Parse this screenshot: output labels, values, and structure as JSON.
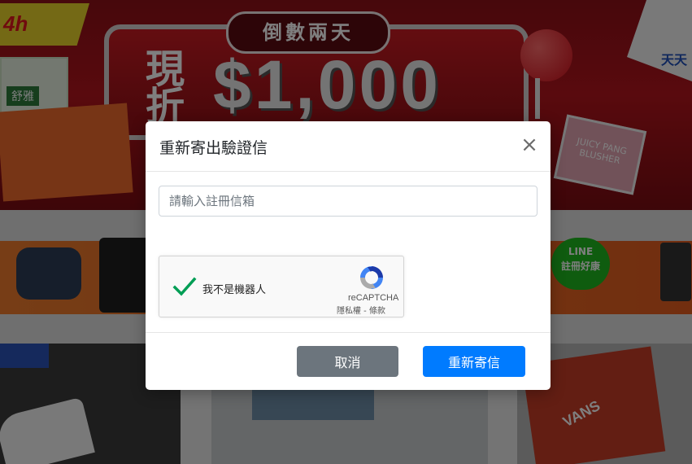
{
  "background": {
    "brand_tag": "4h",
    "countdown": "倒數兩天",
    "promo_prefix": "現折",
    "promo_amount": "$1,000",
    "product_tissue": "舒雅",
    "product_blush": "JUICY PANG BLUSHER",
    "corner_sign": "天天",
    "line_badge": "LINE\n註冊好康",
    "shoe_box": "VANS"
  },
  "modal": {
    "title": "重新寄出驗證信",
    "close_glyph": "×",
    "email_placeholder": "請輸入註冊信箱",
    "email_value": "",
    "recaptcha": {
      "label": "我不是機器人",
      "brand": "reCAPTCHA",
      "privacy": "隱私權",
      "separator": " - ",
      "terms": "條款",
      "checked": true,
      "check_color": "#009e55"
    },
    "cancel_label": "取消",
    "resend_label": "重新寄信"
  },
  "colors": {
    "cancel_button": "#6c757d",
    "resend_button": "#007bff"
  }
}
